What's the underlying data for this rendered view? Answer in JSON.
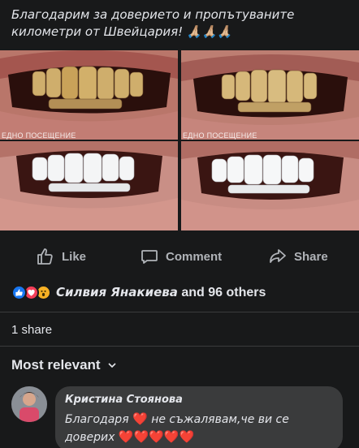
{
  "post": {
    "text": "Благодарим за доверието и пропътуваните километри от Швейцария! 🙏🏼🙏🏼🙏🏼"
  },
  "photos": [
    {
      "caption": "ЕДНО ПОСЕЩЕНИЕ",
      "state": "before"
    },
    {
      "caption": "ЕДНО ПОСЕЩЕНИЕ",
      "state": "before"
    },
    {
      "caption": "",
      "state": "after"
    },
    {
      "caption": "",
      "state": "after"
    }
  ],
  "actions": {
    "like": "Like",
    "comment": "Comment",
    "share": "Share"
  },
  "reactions": {
    "name": "Силвия Янакиева",
    "rest": " and 96 others",
    "icons": [
      "like-icon",
      "love-icon",
      "wow-icon"
    ]
  },
  "shares": "1 share",
  "sort": {
    "label": "Most relevant"
  },
  "comment": {
    "author": "Кристина Стоянова",
    "text_part1": "Благодаря ",
    "text_part2": " не съжалявам,че ви се доверих "
  },
  "colors": {
    "background": "#18191a",
    "bubble": "#3a3b3c",
    "secondary_text": "#b0b3b8",
    "like_blue": "#1877f2",
    "love_red": "#f33e58",
    "wow_yellow": "#f7b125"
  }
}
